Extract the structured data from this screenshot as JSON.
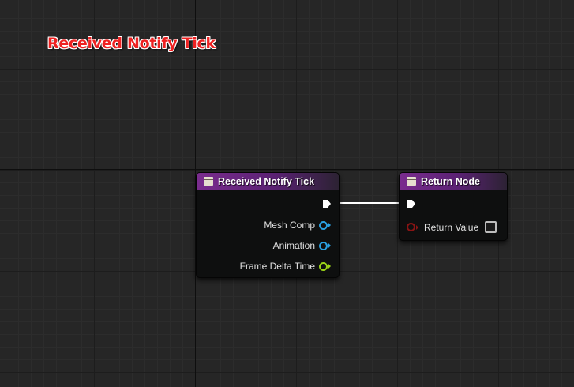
{
  "graph": {
    "title": "Received Notify Tick"
  },
  "nodes": {
    "event": {
      "title": "Received Notify Tick",
      "pins": [
        {
          "label": "Mesh Comp",
          "color": "#2aa0e0"
        },
        {
          "label": "Animation",
          "color": "#2aa0e0"
        },
        {
          "label": "Frame Delta Time",
          "color": "#9ad318"
        }
      ]
    },
    "return": {
      "title": "Return Node",
      "pins": [
        {
          "label": "Return Value",
          "color": "#8a1414"
        }
      ]
    }
  },
  "colors": {
    "header_accent": "#7a2c8e",
    "object_pin": "#2aa0e0",
    "float_pin": "#9ad318",
    "bool_pin": "#8a1414",
    "exec_wire": "#ffffff"
  }
}
